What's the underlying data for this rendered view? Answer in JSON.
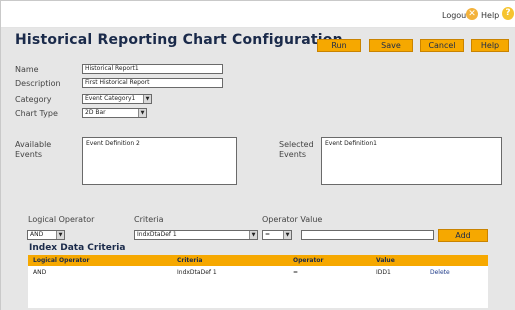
{
  "topbar": {
    "logout_label": "Logout",
    "help_label": "Help",
    "close_glyph": "✕",
    "help_glyph": "?"
  },
  "page": {
    "title": "Historical Reporting Chart Configuration"
  },
  "actions": {
    "run": "Run",
    "save": "Save",
    "cancel": "Cancel",
    "help": "Help"
  },
  "form": {
    "name_label": "Name",
    "name_value": "Historical Report1",
    "description_label": "Description",
    "description_value": "First Historical Report",
    "category_label": "Category",
    "category_value": "Event Category1",
    "chart_type_label": "Chart Type",
    "chart_type_value": "2D Bar",
    "available_label_1": "Available",
    "available_label_2": "Events",
    "available_items": [
      "Event Definition 2"
    ],
    "selected_label_1": "Selected",
    "selected_label_2": "Events",
    "selected_items": [
      "Event Definition1"
    ]
  },
  "criteria_builder": {
    "logical_operator_label": "Logical Operator",
    "logical_operator_value": "AND",
    "criteria_label": "Criteria",
    "criteria_value": "IndxDtaDef 1",
    "operator_value_label": "Operator Value",
    "operator_value": "=",
    "value_input": "",
    "add_label": "Add"
  },
  "index_data": {
    "section_title": "Index Data Criteria",
    "columns": [
      "Logical Operator",
      "Criteria",
      "Operator",
      "Value"
    ],
    "rows": [
      {
        "logical_operator": "AND",
        "criteria": "IndxDtaDef 1",
        "operator": "=",
        "value": "IDD1",
        "action": "Delete"
      }
    ]
  },
  "colors": {
    "accent": "#f6a800",
    "title": "#1a2a4a",
    "panel": "#e6e6e6"
  },
  "icons": {
    "close": "close-circle-icon",
    "help": "help-circle-icon",
    "dropdown": "chevron-down-icon"
  }
}
